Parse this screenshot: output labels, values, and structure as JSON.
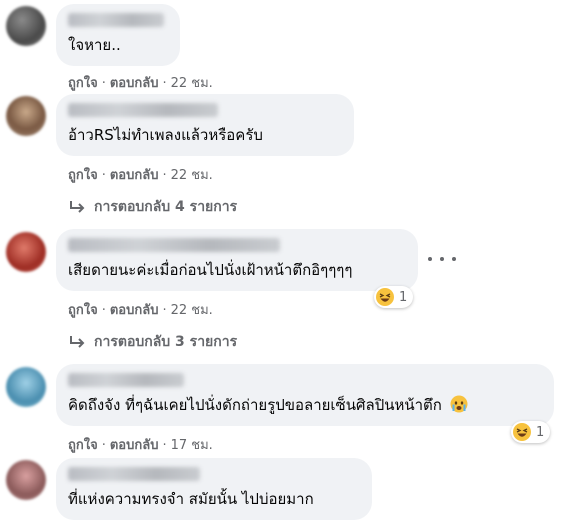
{
  "comments": [
    {
      "text": "ใจหาย..",
      "like": "ถูกใจ",
      "reply": "ตอบกลับ",
      "time": "22 ชม."
    },
    {
      "text": "อ้าวRSไม่ทำเพลงแล้วหรือครับ",
      "like": "ถูกใจ",
      "reply": "ตอบกลับ",
      "time": "22 ชม.",
      "replies": "การตอบกลับ 4 รายการ"
    },
    {
      "text": "เสียดายนะค่ะเมื่อก่อนไปนั่งเฝ้าหน้าตึกอิๆๆๆๆ",
      "like": "ถูกใจ",
      "reply": "ตอบกลับ",
      "time": "22 ชม.",
      "replies": "การตอบกลับ 3 รายการ",
      "reaction": {
        "emoji": "laughing",
        "count": "1"
      }
    },
    {
      "text": "คิดถึงจัง ที่ๆฉันเคยไปนั่งดักถ่ายรูปขอลายเซ็นศิลปินหน้าตึก",
      "like": "ถูกใจ",
      "reply": "ตอบกลับ",
      "time": "17 ชม.",
      "inline_emoji": "crying",
      "reaction": {
        "emoji": "laughing",
        "count": "1"
      }
    },
    {
      "text": "ที่แห่งความทรงจำ สมัยนั้น ไปบ่อยมาก"
    }
  ],
  "separator": "·",
  "icons": {
    "reply": "reply-arrow-icon",
    "more": "more-options-icon",
    "reaction": "haha-reaction-icon",
    "inline": "crying-face-icon"
  },
  "colors": {
    "bubble": "#f0f2f5",
    "meta": "#65676b",
    "text": "#050505"
  }
}
